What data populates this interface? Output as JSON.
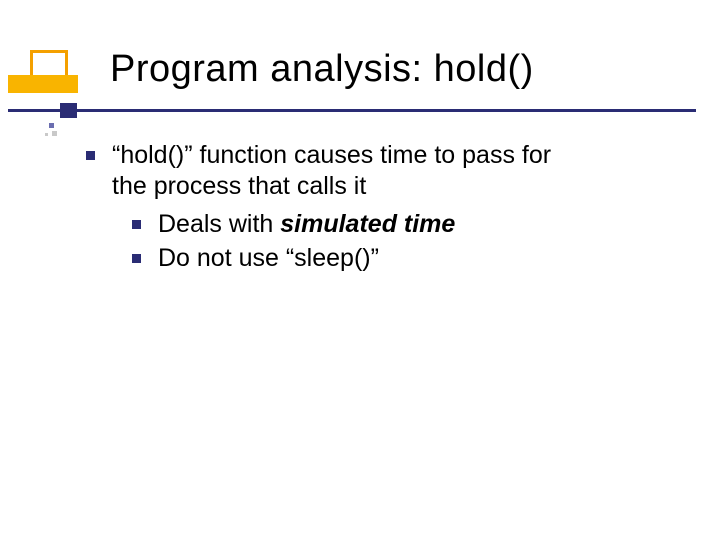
{
  "title": "Program analysis: hold()",
  "bullet1_a": "“hold()” function causes time to pass for",
  "bullet1_b": "the process that calls it",
  "sub1_pre": "Deals with ",
  "sub1_em": "simulated time",
  "sub2": "Do not use “sleep()”"
}
